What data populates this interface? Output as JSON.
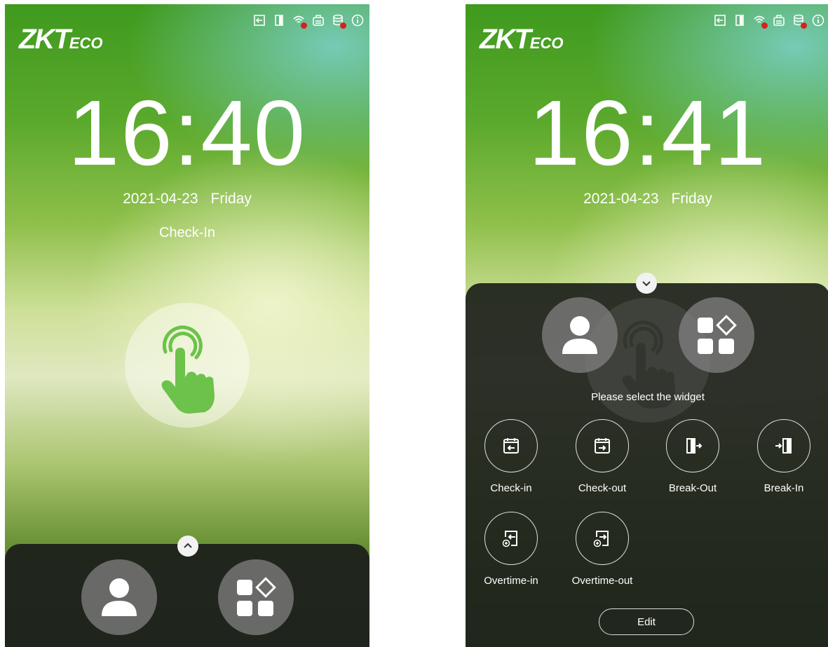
{
  "screens": [
    {
      "brand": {
        "main": "ZKT",
        "suffix": "ECO"
      },
      "time": "16:40",
      "date": "2021-04-23",
      "weekday": "Friday",
      "state": "Check-In"
    },
    {
      "brand": {
        "main": "ZKT",
        "suffix": "ECO"
      },
      "time": "16:41",
      "date": "2021-04-23",
      "weekday": "Friday",
      "hint": "Please select the widget",
      "widgets": [
        {
          "label": "Check-in",
          "icon": "check-in-icon"
        },
        {
          "label": "Check-out",
          "icon": "check-out-icon"
        },
        {
          "label": "Break-Out",
          "icon": "break-out-icon"
        },
        {
          "label": "Break-In",
          "icon": "break-in-icon"
        },
        {
          "label": "Overtime-in",
          "icon": "overtime-in-icon"
        },
        {
          "label": "Overtime-out",
          "icon": "overtime-out-icon"
        }
      ],
      "edit_label": "Edit"
    }
  ],
  "status_icons": [
    "door-exit-icon",
    "door-icon",
    "wifi-disconnected-icon",
    "network-icon",
    "database-error-icon",
    "info-icon"
  ],
  "colors": {
    "accent_green": "#6cc24a",
    "error_red": "#d82020",
    "panel_dark": "#1e211c"
  }
}
